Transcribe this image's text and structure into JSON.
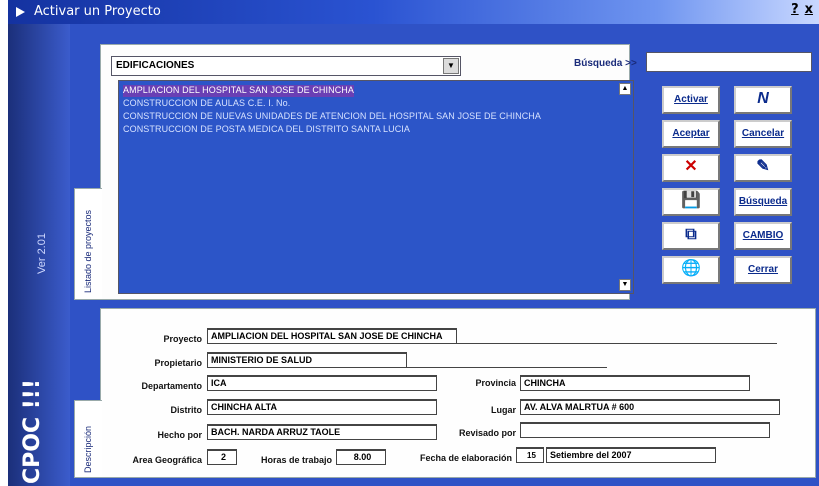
{
  "window": {
    "title": "Activar un Proyecto",
    "help": "?",
    "close": "x"
  },
  "brand": {
    "name": "CPOC !!!",
    "version": "Ver 2.01"
  },
  "tabs": {
    "list": "Listado de proyectos",
    "desc": "Descripción"
  },
  "filter": {
    "category": "EDIFICACIONES",
    "search_label": "Búsqueda >>",
    "search_value": ""
  },
  "projects": [
    "AMPLIACION DEL HOSPITAL SAN JOSE DE CHINCHA",
    "CONSTRUCCION DE AULAS C.E. I. No.",
    "CONSTRUCCION DE NUEVAS UNIDADES DE ATENCION DEL HOSPITAL SAN JOSE DE CHINCHA",
    "CONSTRUCCION DE POSTA MEDICA DEL DISTRITO SANTA LUCIA"
  ],
  "buttons": {
    "activar": "Activar",
    "nuevo": "N",
    "aceptar": "Aceptar",
    "cancelar": "Cancelar",
    "eliminar": "✕",
    "editar": "✎",
    "guardar": "💾",
    "busqueda": "Búsqueda",
    "copiar": "⧉",
    "cambio": "CAMBIO",
    "mundo": "🌐",
    "cerrar": "Cerrar"
  },
  "form": {
    "proyecto_label": "Proyecto",
    "proyecto": "AMPLIACION DEL HOSPITAL SAN JOSE DE CHINCHA",
    "propietario_label": "Propietario",
    "propietario": "MINISTERIO DE SALUD",
    "departamento_label": "Departamento",
    "departamento": "ICA",
    "provincia_label": "Provincia",
    "provincia": "CHINCHA",
    "distrito_label": "Distrito",
    "distrito": "CHINCHA ALTA",
    "lugar_label": "Lugar",
    "lugar": "AV. ALVA MALRTUA  #  600",
    "hecho_label": "Hecho por",
    "hecho": "BACH. NARDA ARRUZ TAOLE",
    "revisado_label": "Revisado por",
    "revisado": "",
    "area_label": "Area Geográfica",
    "area": "2",
    "horas_label": "Horas de trabajo",
    "horas": "8.00",
    "fecha_label": "Fecha de elaboración",
    "fecha": "Setiembre del 2007",
    "fecha_day": "15"
  }
}
